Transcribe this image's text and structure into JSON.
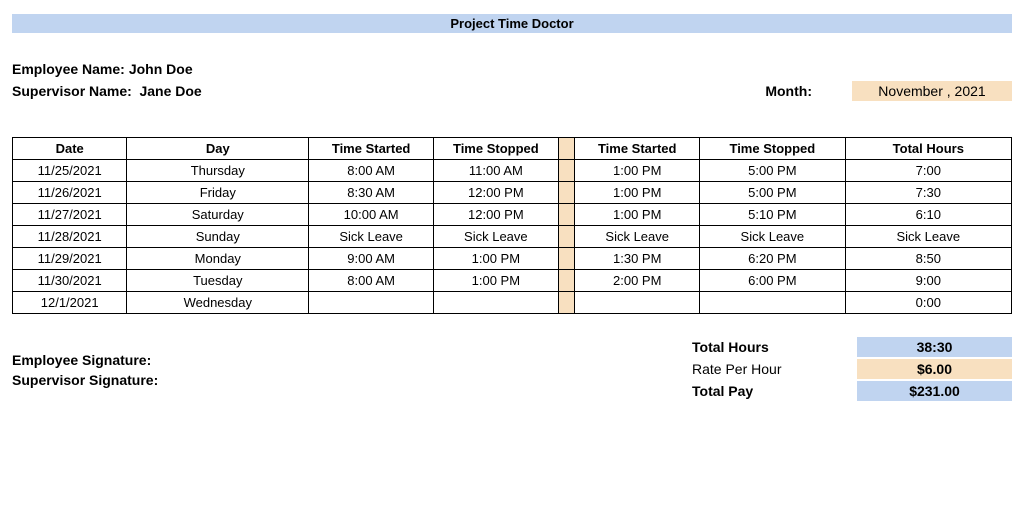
{
  "title": "Project Time Doctor",
  "employee_label": "Employee Name:",
  "employee_name": "John Doe",
  "supervisor_label": "Supervisor Name:",
  "supervisor_name": "Jane Doe",
  "month_label": "Month:",
  "month_value": "November , 2021",
  "columns": {
    "date": "Date",
    "day": "Day",
    "ts1": "Time Started",
    "te1": "Time Stopped",
    "ts2": "Time Started",
    "te2": "Time Stopped",
    "total": "Total Hours"
  },
  "rows": [
    {
      "date": "11/25/2021",
      "day": "Thursday",
      "ts1": "8:00 AM",
      "te1": "11:00 AM",
      "ts2": "1:00 PM",
      "te2": "5:00 PM",
      "total": "7:00"
    },
    {
      "date": "11/26/2021",
      "day": "Friday",
      "ts1": "8:30 AM",
      "te1": "12:00 PM",
      "ts2": "1:00 PM",
      "te2": "5:00 PM",
      "total": "7:30"
    },
    {
      "date": "11/27/2021",
      "day": "Saturday",
      "ts1": "10:00 AM",
      "te1": "12:00 PM",
      "ts2": "1:00 PM",
      "te2": "5:10 PM",
      "total": "6:10"
    },
    {
      "date": "11/28/2021",
      "day": "Sunday",
      "ts1": "Sick Leave",
      "te1": "Sick Leave",
      "ts2": "Sick Leave",
      "te2": "Sick Leave",
      "total": "Sick Leave"
    },
    {
      "date": "11/29/2021",
      "day": "Monday",
      "ts1": "9:00 AM",
      "te1": "1:00 PM",
      "ts2": "1:30 PM",
      "te2": "6:20 PM",
      "total": "8:50"
    },
    {
      "date": "11/30/2021",
      "day": "Tuesday",
      "ts1": "8:00 AM",
      "te1": "1:00 PM",
      "ts2": "2:00 PM",
      "te2": "6:00 PM",
      "total": "9:00"
    },
    {
      "date": "12/1/2021",
      "day": "Wednesday",
      "ts1": "",
      "te1": "",
      "ts2": "",
      "te2": "",
      "total": "0:00"
    }
  ],
  "summary": {
    "total_hours_label": "Total Hours",
    "total_hours_value": "38:30",
    "rate_label": "Rate Per Hour",
    "rate_value": "$6.00",
    "total_pay_label": "Total Pay",
    "total_pay_value": "$231.00"
  },
  "signatures": {
    "employee": "Employee Signature:",
    "supervisor": "Supervisor Signature:"
  }
}
